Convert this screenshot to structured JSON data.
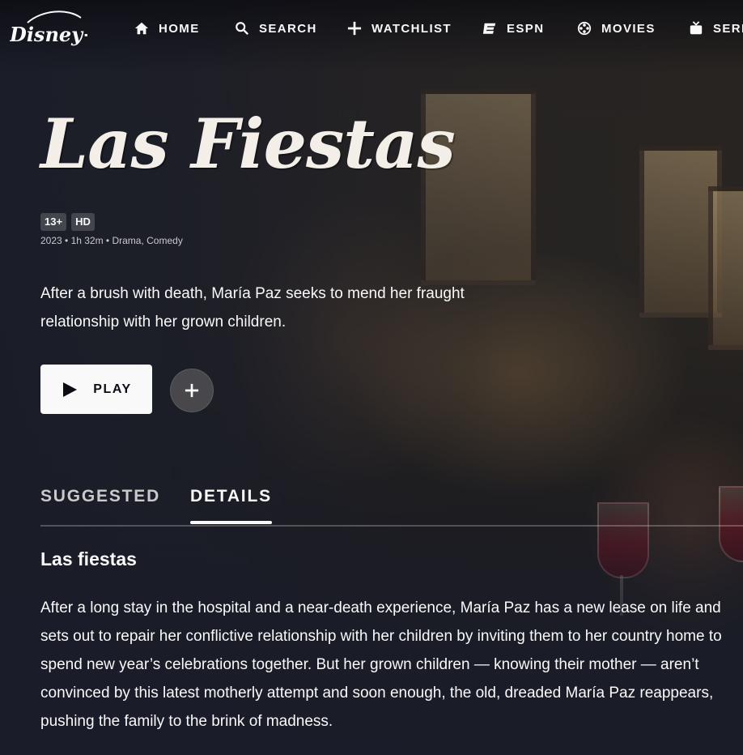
{
  "nav": {
    "brand": "Disney+",
    "items": [
      {
        "label": "HOME",
        "icon": "home-icon"
      },
      {
        "label": "SEARCH",
        "icon": "search-icon"
      },
      {
        "label": "WATCHLIST",
        "icon": "plus-icon"
      },
      {
        "label": "ESPN",
        "icon": "espn-icon"
      },
      {
        "label": "MOVIES",
        "icon": "film-reel-icon"
      },
      {
        "label": "SERI",
        "icon": "tv-icon"
      }
    ]
  },
  "title": {
    "logo_text": "Las Fiestas",
    "badges": [
      "13+",
      "HD"
    ],
    "meta": "2023 • 1h 32m • Drama, Comedy",
    "tagline": "After a brush with death, María Paz seeks to mend her fraught relationship with her grown children."
  },
  "actions": {
    "play_label": "PLAY",
    "add_icon": "plus-icon"
  },
  "tabs": [
    {
      "label": "SUGGESTED",
      "active": false
    },
    {
      "label": "DETAILS",
      "active": true
    }
  ],
  "details": {
    "heading": "Las fiestas",
    "description": "After a long stay in the hospital and a near-death experience, María Paz has a new lease on life and sets out to repair her conflictive relationship with her children by inviting them to her country home to spend new year’s celebrations together. But her grown children — knowing their mother — aren’t convinced by this latest motherly attempt and soon enough, the old, dreaded María Paz reappears, pushing the family to the brink of madness."
  },
  "colors": {
    "background": "#1a1d29",
    "text": "#f9f9f9",
    "muted_text": "#cacaca",
    "play_button": "#f9f9f9"
  }
}
